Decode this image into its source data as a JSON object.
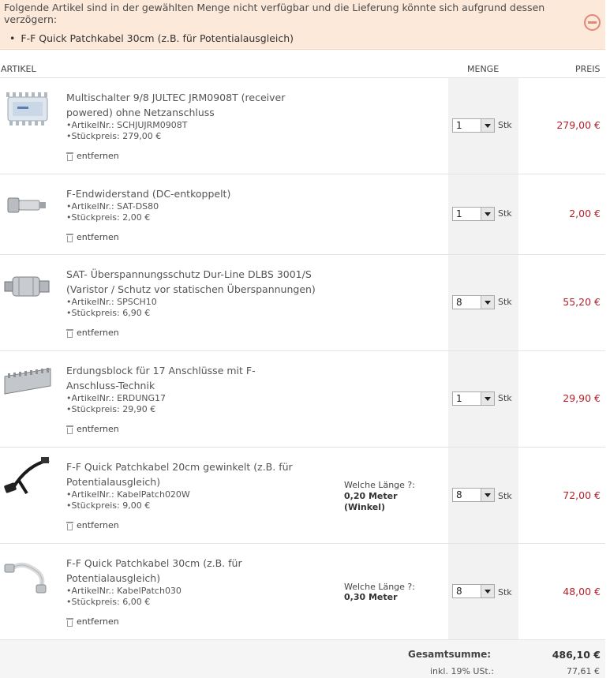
{
  "warning": {
    "text": "Folgende Artikel sind in der gewählten Menge nicht verfügbar und die Lieferung könnte sich aufgrund dessen verzögern:",
    "items": [
      "F-F Quick Patchkabel 30cm (z.B. für Potentialausgleich)"
    ]
  },
  "table": {
    "header_artikel": "ARTIKEL",
    "header_menge": "MENGE",
    "header_preis": "PREIS"
  },
  "items": [
    {
      "name": "Multischalter 9/8 JULTEC JRM0908T (receiver powered) ohne Netzanschluss",
      "artikelnr": "ArtikelNr.: SCHJUJRM0908T",
      "stueckpreis": "Stückpreis: 279,00 €",
      "remove": "entfernen",
      "qty": "1",
      "unit": "Stk",
      "price": "279,00 €",
      "image_icon": "multiswitch-image"
    },
    {
      "name": "F-Endwiderstand (DC-entkoppelt)",
      "artikelnr": "ArtikelNr.: SAT-DS80",
      "stueckpreis": "Stückpreis: 2,00 €",
      "remove": "entfernen",
      "qty": "1",
      "unit": "Stk",
      "price": "2,00 €",
      "image_icon": "terminator-image"
    },
    {
      "name": "SAT- Überspannungsschutz Dur-Line DLBS 3001/S (Varistor / Schutz vor statischen Überspannungen)",
      "artikelnr": "ArtikelNr.: SPSCH10",
      "stueckpreis": "Stückpreis: 6,90 €",
      "remove": "entfernen",
      "qty": "8",
      "unit": "Stk",
      "price": "55,20 €",
      "image_icon": "surge-protector-image"
    },
    {
      "name": "Erdungsblock für 17 Anschlüsse mit F-Anschluss-Technik",
      "artikelnr": "ArtikelNr.: ERDUNG17",
      "stueckpreis": "Stückpreis: 29,90 €",
      "remove": "entfernen",
      "qty": "1",
      "unit": "Stk",
      "price": "29,90 €",
      "image_icon": "grounding-block-image"
    },
    {
      "name": "F-F Quick Patchkabel 20cm gewinkelt (z.B. für Potentialausgleich)",
      "artikelnr": "ArtikelNr.: KabelPatch020W",
      "stueckpreis": "Stückpreis: 9,00 €",
      "remove": "entfernen",
      "option_label": "Welche Länge ?:",
      "option_value_line1": "0,20 Meter",
      "option_value_line2": "(Winkel)",
      "qty": "8",
      "unit": "Stk",
      "price": "72,00 €",
      "image_icon": "black-cable-image"
    },
    {
      "name": "F-F Quick Patchkabel 30cm (z.B. für Potentialausgleich)",
      "artikelnr": "ArtikelNr.: KabelPatch030",
      "stueckpreis": "Stückpreis: 6,00 €",
      "remove": "entfernen",
      "option_label": "Welche Länge ?:",
      "option_value_line1": "0,30 Meter",
      "qty": "8",
      "unit": "Stk",
      "price": "48,00 €",
      "image_icon": "white-cable-image"
    }
  ],
  "totals": {
    "sum_label": "Gesamtsumme:",
    "sum_value": "486,10 €",
    "tax_label": "inkl. 19% USt.:",
    "tax_value": "77,61 €"
  },
  "colors": {
    "warning_bg": "#fde9d9",
    "price_red": "#b4212a",
    "qty_column_bg": "#f2f2f2"
  }
}
